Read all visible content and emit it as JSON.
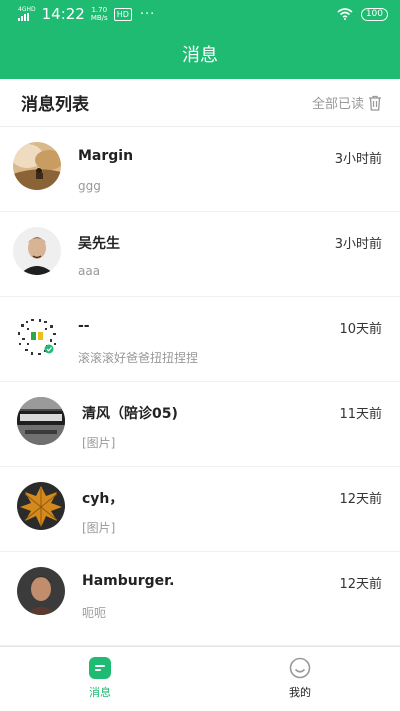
{
  "status_bar": {
    "network": "4GHD",
    "time": "14:22",
    "speed_value": "1.70",
    "speed_unit": "MB/s",
    "hd_badge": "HD",
    "more": "···",
    "battery": "100"
  },
  "header": {
    "title": "消息"
  },
  "list_header": {
    "title": "消息列表",
    "mark_all_read": "全部已读"
  },
  "messages": [
    {
      "name": "Margin",
      "preview": "ggg",
      "time": "3小时前"
    },
    {
      "name": "吴先生",
      "preview": "aaa",
      "time": "3小时前"
    },
    {
      "name": "--",
      "preview": "滚滚滚好爸爸扭扭捏捏",
      "time": "10天前"
    },
    {
      "name": "清风（陪诊05)",
      "preview": "[图片]",
      "time": "11天前"
    },
    {
      "name": "cyh，",
      "preview": "[图片]",
      "time": "12天前"
    },
    {
      "name": "Hamburger.",
      "preview": "呃呃",
      "time": "12天前"
    }
  ],
  "tabs": [
    {
      "label": "消息",
      "active": true
    },
    {
      "label": "我的",
      "active": false
    }
  ],
  "colors": {
    "brand_green": "#1fbb72",
    "muted_text": "#999999"
  }
}
